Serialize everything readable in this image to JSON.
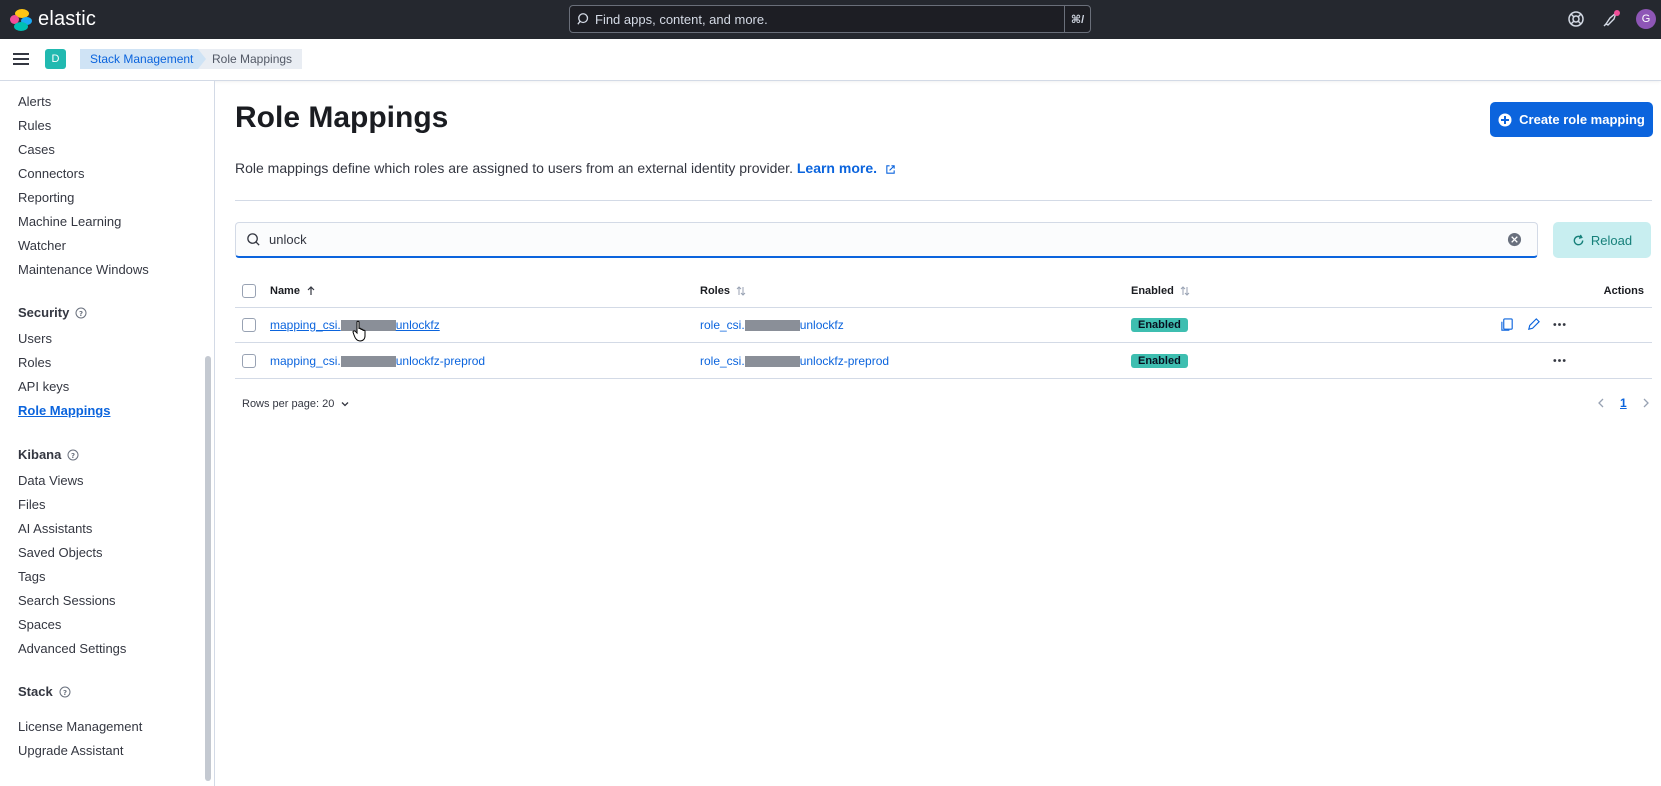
{
  "header": {
    "logo_text": "elastic",
    "search_placeholder": "Find apps, content, and more.",
    "search_shortcut": "⌘/",
    "avatar_initial": "G"
  },
  "subheader": {
    "space_initial": "D",
    "breadcrumbs": [
      "Stack Management",
      "Role Mappings"
    ]
  },
  "sidebar": {
    "items_top": [
      "Alerts",
      "Rules",
      "Cases",
      "Connectors",
      "Reporting",
      "Machine Learning",
      "Watcher",
      "Maintenance Windows"
    ],
    "security": {
      "title": "Security",
      "items": [
        "Users",
        "Roles",
        "API keys",
        "Role Mappings"
      ]
    },
    "kibana": {
      "title": "Kibana",
      "items": [
        "Data Views",
        "Files",
        "AI Assistants",
        "Saved Objects",
        "Tags",
        "Search Sessions",
        "Spaces",
        "Advanced Settings"
      ]
    },
    "stack": {
      "title": "Stack",
      "items": [
        "License Management",
        "Upgrade Assistant"
      ]
    }
  },
  "main": {
    "title": "Role Mappings",
    "create_button": "Create role mapping",
    "description": "Role mappings define which roles are assigned to users from an external identity provider.",
    "learn_more": "Learn more.",
    "search_value": "unlock",
    "reload_button": "Reload",
    "columns": {
      "name": "Name",
      "roles": "Roles",
      "enabled": "Enabled",
      "actions": "Actions"
    },
    "rows": [
      {
        "name_prefix": "mapping_csi.",
        "name_suffix": "unlockfz",
        "role_prefix": "role_csi.",
        "role_suffix": "unlockfz",
        "status": "Enabled"
      },
      {
        "name_prefix": "mapping_csi.",
        "name_suffix": "unlockfz-preprod",
        "role_prefix": "role_csi.",
        "role_suffix": "unlockfz-preprod",
        "status": "Enabled"
      }
    ],
    "rows_per_page": "Rows per page: 20",
    "current_page": "1"
  },
  "colors": {
    "header_bg": "#25282f",
    "primary": "#0b64dd",
    "badge": "#3ebeb0",
    "reload_bg": "#c8eef0"
  }
}
